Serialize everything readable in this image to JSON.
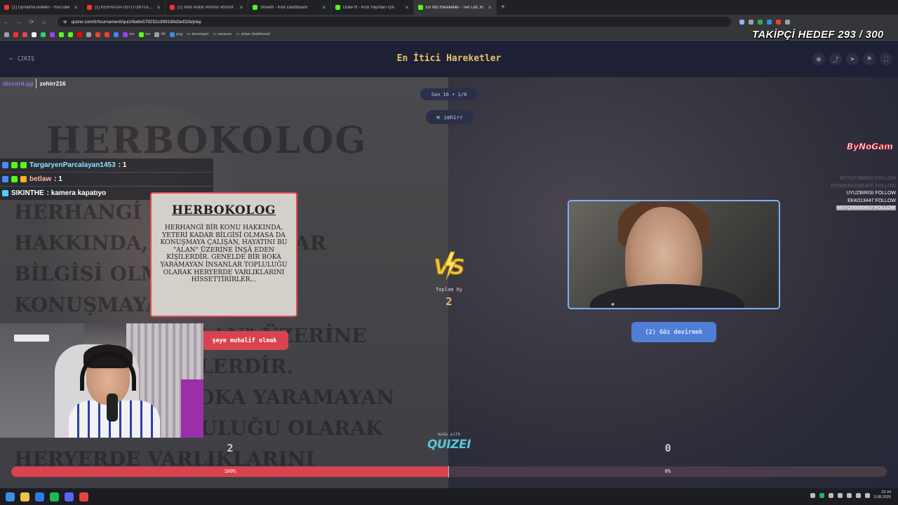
{
  "browser": {
    "tabs": [
      {
        "label": "(1) Oynatma listeleri - YouTube",
        "color": "#ff3030"
      },
      {
        "label": "(1) KENYA'DA ÜSTÜ ÖRTÜLEN",
        "color": "#ff3030"
      },
      {
        "label": "(1) Void visitor #horror #horror",
        "color": "#ff3030"
      },
      {
        "label": "Stream - Kick Dashboard",
        "color": "#53fc18"
      },
      {
        "label": "Draw It! - Kick Yayınları İçin",
        "color": "#53fc18"
      },
      {
        "label": "En İtici Hareketler - Tier List, Kı",
        "color": "#53fc18",
        "active": true
      }
    ],
    "url": "quizei.com/tr/tournament/quiz/6a6e579252c399189d3ef32b/play",
    "bookmarks": [
      "me",
      "me",
      "4K",
      "png",
      "developer",
      "amazon",
      "stripe dashboard"
    ]
  },
  "overlay": {
    "follower_goal": "TAKİPÇİ HEDEF 293 / 300",
    "discord_label": "discord.gg",
    "discord_user": "zehirr216",
    "chat": [
      {
        "name": "TargaryenParcalayan1453",
        "message": ": 1",
        "name_color": "#8fe3ff"
      },
      {
        "name": "betlaw",
        "message": ": 1",
        "name_color": "#ffb0a0"
      },
      {
        "name": "SIKINTHE",
        "message": ": kamera kapatıyo",
        "name_color": "#ffffff"
      }
    ],
    "brand_text": "ByNoGam",
    "follows": [
      {
        "text": "BTYUYZBIRISI FOLLOW",
        "style": "dim"
      },
      {
        "text": "FYOAKEKGSEATE FOLLOW",
        "style": "dim"
      },
      {
        "text": "UYUZBIRISI FOLLOW",
        "style": "normal"
      },
      {
        "text": "EKK013447 FOLLOW",
        "style": "normal"
      },
      {
        "text": "MSTQ06090807 FOLLOW",
        "style": "hl"
      }
    ]
  },
  "page": {
    "exit_label": "ÇIKIŞ",
    "title": "En İtici Hareketler",
    "round": "Son 16 • 1/8",
    "user": "zehirr",
    "left": {
      "card_title": "HERBOKOLOG",
      "card_body": "HERHANGİ BİR KONU HAKKINDA, YETERİ KADAR BİLGİSİ OLMASA DA KONUŞMAYA ÇALIŞAN, HAYATINI BU \"ALAN\" ÜZERİNE İNŞÂ EDEN KİŞİLERDİR. GENELDE BİR BOKA YARAMAYAN İNSANLAR TOPLULUĞU OLARAK HERYERDE VARLIKLARINI HİSSETTİRİRLER...",
      "button": "şeye muhalif olmak",
      "votes": "2",
      "percent_label": "100%",
      "percent": 100
    },
    "right": {
      "button": "(2) Göz devirmek",
      "votes": "0",
      "percent_label": "0%",
      "percent": 0
    },
    "total_label": "Toplam Oy",
    "total_value": "2",
    "made_with": "made with",
    "logo_text": "QUIZEI"
  },
  "taskbar": {
    "time": "23:34",
    "date": "3.08.2026"
  }
}
